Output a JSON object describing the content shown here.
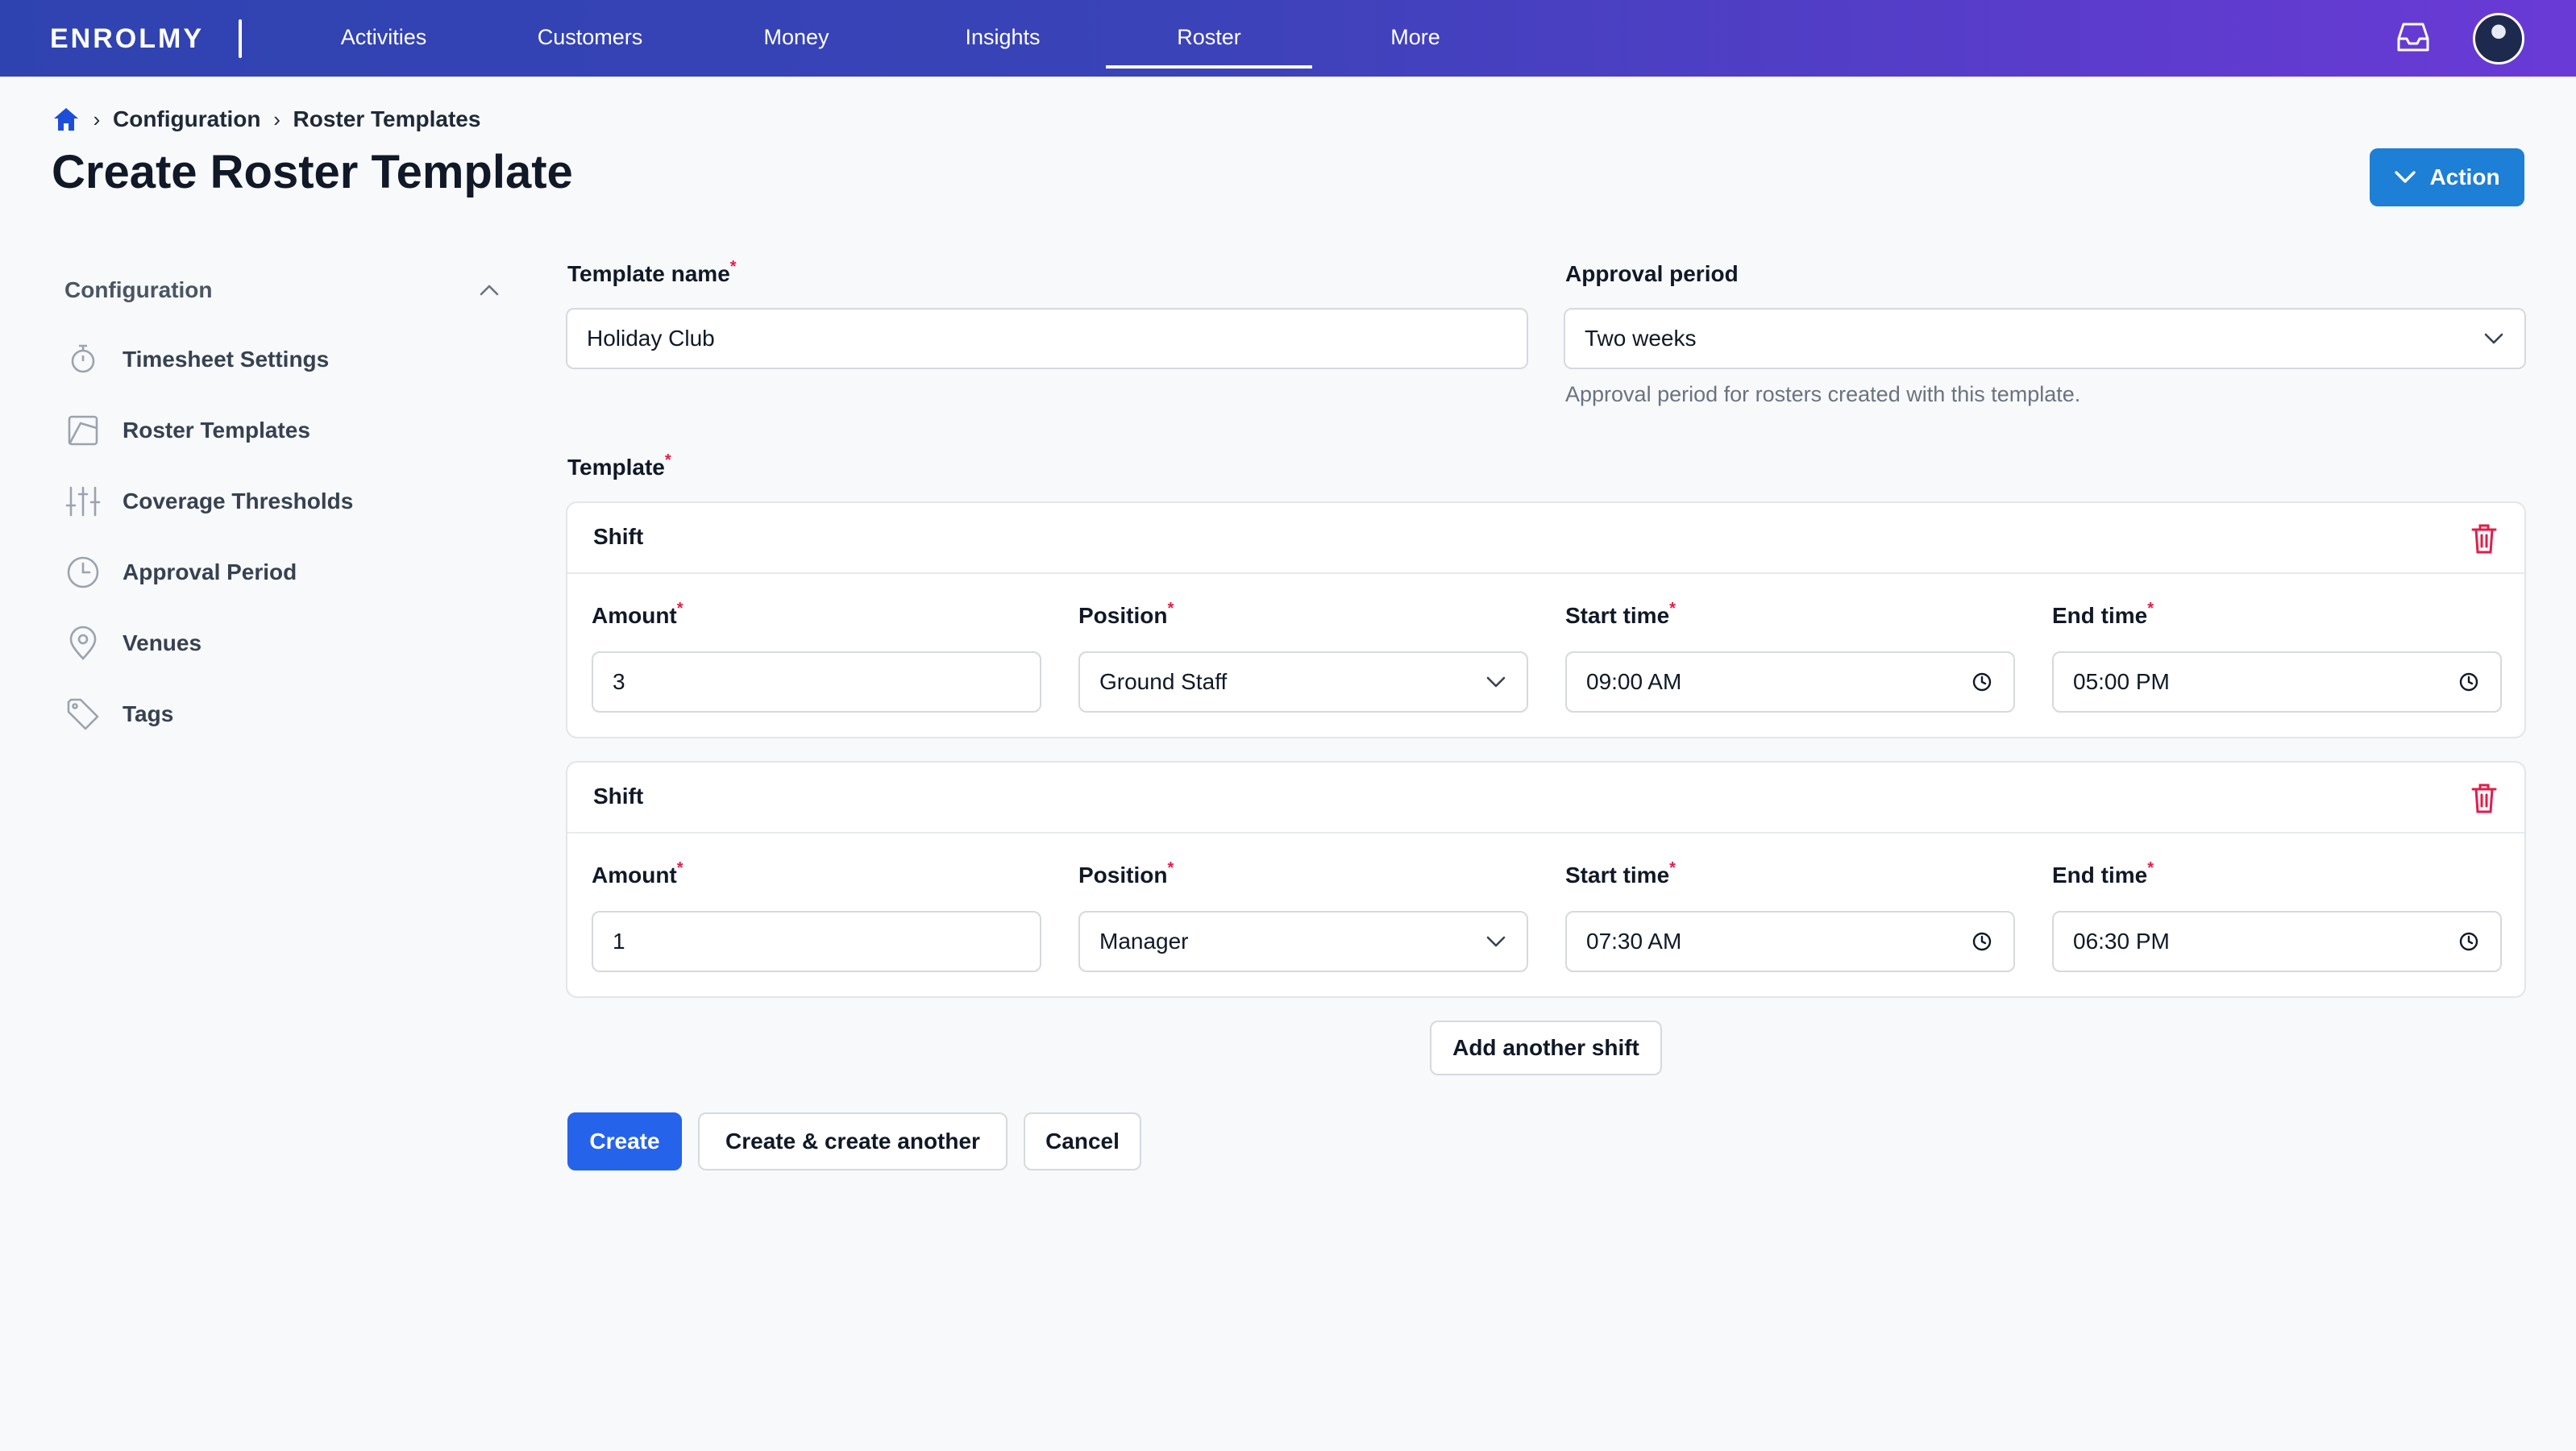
{
  "app": {
    "logo": "ENROLMY"
  },
  "nav": {
    "items": [
      "Activities",
      "Customers",
      "Money",
      "Insights",
      "Roster",
      "More"
    ],
    "active": "Roster"
  },
  "breadcrumb": {
    "items": [
      "Configuration",
      "Roster Templates"
    ]
  },
  "page": {
    "title": "Create Roster Template",
    "action_label": "Action"
  },
  "sidebar": {
    "heading": "Configuration",
    "items": [
      {
        "label": "Timesheet Settings",
        "icon": "stopwatch-icon"
      },
      {
        "label": "Roster Templates",
        "icon": "template-icon"
      },
      {
        "label": "Coverage Thresholds",
        "icon": "sliders-icon"
      },
      {
        "label": "Approval Period",
        "icon": "clock-icon"
      },
      {
        "label": "Venues",
        "icon": "map-pin-icon"
      },
      {
        "label": "Tags",
        "icon": "tag-icon"
      }
    ]
  },
  "form": {
    "template_name": {
      "label": "Template name",
      "value": "Holiday Club"
    },
    "approval_period": {
      "label": "Approval period",
      "value": "Two weeks",
      "help": "Approval period for rosters created with this template."
    },
    "template_label": "Template",
    "shifts": [
      {
        "title": "Shift",
        "amount_label": "Amount",
        "amount": "3",
        "position_label": "Position",
        "position": "Ground Staff",
        "start_label": "Start time",
        "start": "09:00 AM",
        "end_label": "End time",
        "end": "05:00 PM"
      },
      {
        "title": "Shift",
        "amount_label": "Amount",
        "amount": "1",
        "position_label": "Position",
        "position": "Manager",
        "start_label": "Start time",
        "start": "07:30 AM",
        "end_label": "End time",
        "end": "06:30 PM"
      }
    ],
    "add_shift_label": "Add another shift",
    "buttons": {
      "create": "Create",
      "create_another": "Create & create another",
      "cancel": "Cancel"
    }
  },
  "colors": {
    "brand_primary": "#2563eb",
    "action": "#1d7fd6",
    "required": "#e11d48",
    "delete": "#e11d48"
  }
}
